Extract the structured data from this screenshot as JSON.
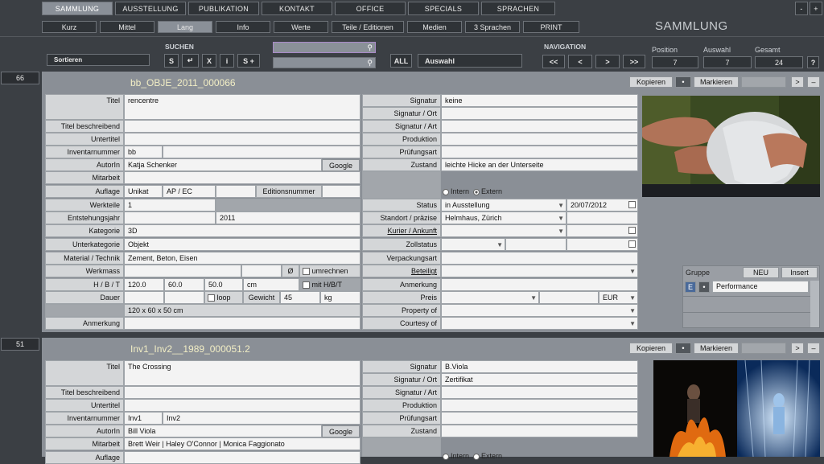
{
  "tabs": [
    "SAMMLUNG",
    "AUSSTELLUNG",
    "PUBLIKATION",
    "KONTAKT",
    "OFFICE",
    "SPECIALS",
    "SPRACHEN"
  ],
  "win_buttons": [
    "-",
    "+"
  ],
  "subtabs": [
    "Kurz",
    "Mittel",
    "Lang",
    "Info",
    "Werte",
    "Teile / Editionen",
    "Medien",
    "3 Sprachen",
    "PRINT"
  ],
  "section_title": "SAMMLUNG",
  "toolbar": {
    "sortieren": "Sortieren",
    "suchen": "SUCHEN",
    "search_buttons": [
      "S",
      "↵",
      "X",
      "i",
      "S +"
    ],
    "all": "ALL",
    "auswahl": "Auswahl",
    "navigation": "NAVIGATION",
    "nav_buttons": [
      "<<",
      "<",
      ">",
      ">>"
    ],
    "position_label": "Position",
    "position": "7",
    "auswahl_label": "Auswahl",
    "auswahl_value": "7",
    "gesamt_label": "Gesamt",
    "gesamt": "24",
    "help": "?"
  },
  "rec_actions": {
    "kopieren": "Kopieren",
    "markieren": "Markieren",
    "next": ">",
    "minus": "–",
    "dot": "•"
  },
  "labels": {
    "titel": "Titel",
    "titel_beschr": "Titel beschreibend",
    "untertitel": "Untertitel",
    "inventar": "Inventarnummer",
    "autor": "AutorIn",
    "mitarbeit": "Mitarbeit",
    "auflage": "Auflage",
    "werkteile": "Werkteile",
    "entstehung": "Entstehungsjahr",
    "kategorie": "Kategorie",
    "unterkategorie": "Unterkategorie",
    "material": "Material / Technik",
    "werkmass": "Werkmass",
    "hbt": "H / B / T",
    "dauer": "Dauer",
    "anmerkung": "Anmerkung",
    "signatur": "Signatur",
    "sig_ort": "Signatur / Ort",
    "sig_art": "Signatur / Art",
    "produktion": "Produktion",
    "pruefung": "Prüfungsart",
    "zustand": "Zustand",
    "status": "Status",
    "standort": "Standort / präzise",
    "kurier": "Kurier / Ankunft",
    "zoll": "Zollstatus",
    "verpackung": "Verpackungsart",
    "beteiligt": "Beteiligt",
    "anmerkung2": "Anmerkung",
    "preis": "Preis",
    "property": "Property of",
    "courtesy": "Courtesy of",
    "google": "Google",
    "editionsnummer": "Editionsnummer",
    "phi": "Ø",
    "umrechnen": "umrechnen",
    "mit_hbt": "mit H/B/T",
    "loop": "loop",
    "gewicht": "Gewicht",
    "intern": "Intern",
    "extern": "Extern",
    "gruppe": "Gruppe",
    "neu": "NEU",
    "insert": "Insert",
    "e": "E"
  },
  "records": [
    {
      "index": "66",
      "id": "bb_OBJE_2011_000066",
      "titel": "rencentre",
      "inv1": "bb",
      "inv2": "",
      "autor": "Katja Schenker",
      "mitarbeit": "",
      "auflage": "Unikat",
      "ap": "AP / EC",
      "werkteile": "1",
      "jahr": "2011",
      "kategorie": "3D",
      "unterkategorie": "Objekt",
      "material": "Zement, Beton, Eisen",
      "h": "120.0",
      "b": "60.0",
      "t": "50.0",
      "unit": "cm",
      "gewicht": "45",
      "gew_unit": "kg",
      "mass_text": "120 x 60 x 50 cm",
      "signatur": "keine",
      "zustand": "leichte Hicke an der Unterseite",
      "status": "in Ausstellung",
      "status_date": "20/07/2012",
      "standort": "Helmhaus, Zürich",
      "currency": "EUR",
      "gruppe_value": "Performance"
    },
    {
      "index": "51",
      "id": "Inv1_Inv2__1989_000051.2",
      "titel": "The Crossing",
      "inv1": "Inv1",
      "inv2": "Inv2",
      "autor": "Bill Viola",
      "mitarbeit": "Brett Weir | Haley O'Connor | Monica Faggionato",
      "signatur": "B.Viola",
      "sig_ort": "Zertifikat"
    }
  ],
  "colors": {
    "background": "#3b3f44",
    "record_bg": "#8a8f96",
    "title": "#f2eec5"
  }
}
